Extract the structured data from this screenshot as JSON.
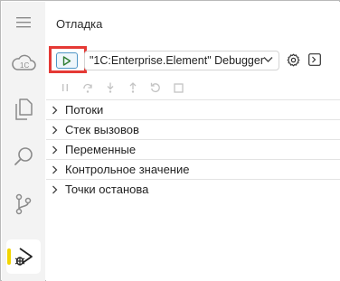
{
  "panel": {
    "title": "Отладка"
  },
  "toolbar": {
    "configuration": "\"1C:Enterprise.Element\" Debugger"
  },
  "activity_bar": {
    "items": [
      "menu-icon",
      "cloud-1c-icon",
      "files-icon",
      "search-icon",
      "source-control-icon",
      "run-debug-icon"
    ]
  },
  "sections": [
    {
      "label": "Потоки"
    },
    {
      "label": "Стек вызовов"
    },
    {
      "label": "Переменные"
    },
    {
      "label": "Контрольное значение"
    },
    {
      "label": "Точки останова"
    }
  ],
  "colors": {
    "highlight": "#e53935",
    "accent": "#f2d500",
    "run_button_border": "#4e96c6",
    "run_triangle": "#2e7d32"
  }
}
